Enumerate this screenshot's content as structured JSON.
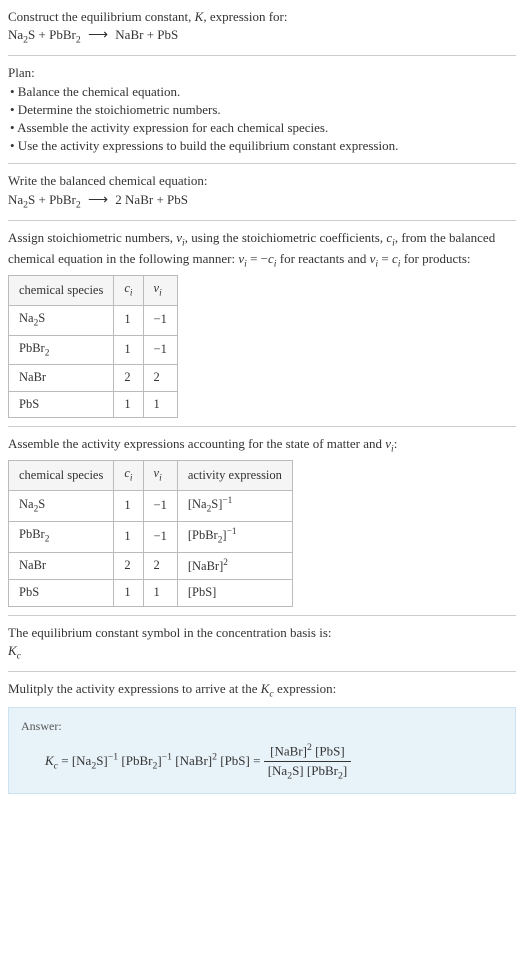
{
  "title_line1": "Construct the equilibrium constant, K, expression for:",
  "title_eq_lhs": "Na₂S + PbBr₂",
  "title_eq_rhs": "NaBr + PbS",
  "plan_header": "Plan:",
  "plan_items": [
    "• Balance the chemical equation.",
    "• Determine the stoichiometric numbers.",
    "• Assemble the activity expression for each chemical species.",
    "• Use the activity expressions to build the equilibrium constant expression."
  ],
  "balanced_header": "Write the balanced chemical equation:",
  "balanced_lhs": "Na₂S + PbBr₂",
  "balanced_rhs": "2 NaBr + PbS",
  "assign_text_1": "Assign stoichiometric numbers, νᵢ, using the stoichiometric coefficients, cᵢ, from the balanced chemical equation in the following manner: νᵢ = −cᵢ for reactants and νᵢ = cᵢ for products:",
  "table1": {
    "headers": [
      "chemical species",
      "cᵢ",
      "νᵢ"
    ],
    "rows": [
      [
        "Na₂S",
        "1",
        "−1"
      ],
      [
        "PbBr₂",
        "1",
        "−1"
      ],
      [
        "NaBr",
        "2",
        "2"
      ],
      [
        "PbS",
        "1",
        "1"
      ]
    ]
  },
  "assemble_text": "Assemble the activity expressions accounting for the state of matter and νᵢ:",
  "table2": {
    "headers": [
      "chemical species",
      "cᵢ",
      "νᵢ",
      "activity expression"
    ],
    "rows": [
      {
        "sp": "Na₂S",
        "c": "1",
        "v": "−1",
        "ae_base": "[Na₂S]",
        "ae_exp": "−1"
      },
      {
        "sp": "PbBr₂",
        "c": "1",
        "v": "−1",
        "ae_base": "[PbBr₂]",
        "ae_exp": "−1"
      },
      {
        "sp": "NaBr",
        "c": "2",
        "v": "2",
        "ae_base": "[NaBr]",
        "ae_exp": "2"
      },
      {
        "sp": "PbS",
        "c": "1",
        "v": "1",
        "ae_base": "[PbS]",
        "ae_exp": ""
      }
    ]
  },
  "kc_text": "The equilibrium constant symbol in the concentration basis is:",
  "kc_symbol": "K_c",
  "multiply_text": "Mulitply the activity expressions to arrive at the K_c expression:",
  "answer_label": "Answer:",
  "answer_prefix": "K_c = ",
  "answer_flat_parts": [
    {
      "b": "[Na₂S]",
      "e": "−1"
    },
    {
      "b": "[PbBr₂]",
      "e": "−1"
    },
    {
      "b": "[NaBr]",
      "e": "2"
    },
    {
      "b": "[PbS]",
      "e": ""
    }
  ],
  "answer_frac": {
    "num": [
      {
        "b": "[NaBr]",
        "e": "2"
      },
      {
        "b": "[PbS]",
        "e": ""
      }
    ],
    "den": [
      {
        "b": "[Na₂S]",
        "e": ""
      },
      {
        "b": "[PbBr₂]",
        "e": ""
      }
    ]
  },
  "chart_data": {
    "type": "table",
    "title": "Stoichiometric and activity data",
    "tables": [
      {
        "columns": [
          "chemical species",
          "c_i",
          "nu_i"
        ],
        "rows": [
          [
            "Na2S",
            1,
            -1
          ],
          [
            "PbBr2",
            1,
            -1
          ],
          [
            "NaBr",
            2,
            2
          ],
          [
            "PbS",
            1,
            1
          ]
        ]
      },
      {
        "columns": [
          "chemical species",
          "c_i",
          "nu_i",
          "activity expression"
        ],
        "rows": [
          [
            "Na2S",
            1,
            -1,
            "[Na2S]^-1"
          ],
          [
            "PbBr2",
            1,
            -1,
            "[PbBr2]^-1"
          ],
          [
            "NaBr",
            2,
            2,
            "[NaBr]^2"
          ],
          [
            "PbS",
            1,
            1,
            "[PbS]"
          ]
        ]
      }
    ]
  }
}
